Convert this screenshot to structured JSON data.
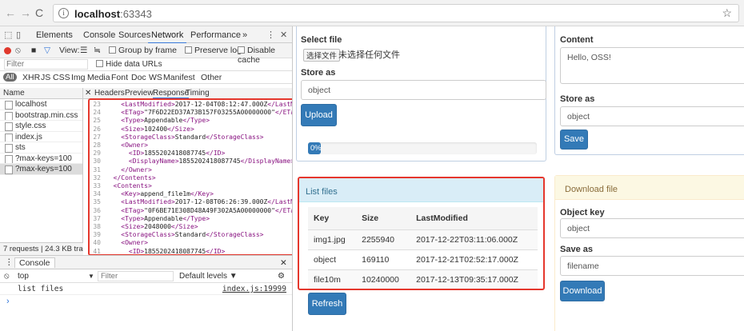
{
  "browser": {
    "url_host": "localhost",
    "url_port": ":63343"
  },
  "devtools": {
    "tabs": [
      "Elements",
      "Console",
      "Sources",
      "Network",
      "Performance",
      "»"
    ],
    "toolbar": {
      "view_label": "View:",
      "group_by_frame": "Group by frame",
      "preserve_log": "Preserve log",
      "disable_cache": "Disable cache"
    },
    "filter_placeholder": "Filter",
    "hide_data_urls": "Hide data URLs",
    "types": [
      "All",
      "XHR",
      "JS",
      "CSS",
      "Img",
      "Media",
      "Font",
      "Doc",
      "WS",
      "Manifest",
      "Other"
    ],
    "name_header": "Name",
    "requests": [
      {
        "name": "localhost",
        "selected": false
      },
      {
        "name": "bootstrap.min.css",
        "selected": false
      },
      {
        "name": "style.css",
        "selected": false
      },
      {
        "name": "index.js",
        "selected": false
      },
      {
        "name": "sts",
        "selected": false
      },
      {
        "name": "?max-keys=100",
        "selected": false
      },
      {
        "name": "?max-keys=100",
        "selected": true
      }
    ],
    "status": "7 requests | 24.3 KB tra...",
    "detail_tabs": [
      "Headers",
      "Preview",
      "Response",
      "Timing"
    ],
    "response_lines": [
      {
        "n": "23",
        "indent": "    ",
        "open": "<LastModified>",
        "text": "2017-12-04T08:12:47.000Z",
        "close": "</LastMod"
      },
      {
        "n": "24",
        "indent": "    ",
        "open": "<ETag>",
        "text": "\"7F6D22ED37A73B157F03255A00000000\"",
        "close": "</ETag>"
      },
      {
        "n": "25",
        "indent": "    ",
        "open": "<Type>",
        "text": "Appendable",
        "close": "</Type>"
      },
      {
        "n": "26",
        "indent": "    ",
        "open": "<Size>",
        "text": "102400",
        "close": "</Size>"
      },
      {
        "n": "27",
        "indent": "    ",
        "open": "<StorageClass>",
        "text": "Standard",
        "close": "</StorageClass>"
      },
      {
        "n": "28",
        "indent": "    ",
        "open": "<Owner>",
        "text": "",
        "close": ""
      },
      {
        "n": "29",
        "indent": "      ",
        "open": "<ID>",
        "text": "1855202418087745",
        "close": "</ID>"
      },
      {
        "n": "30",
        "indent": "      ",
        "open": "<DisplayName>",
        "text": "1855202418087745",
        "close": "</DisplayName>"
      },
      {
        "n": "31",
        "indent": "    ",
        "open": "</Owner>",
        "text": "",
        "close": ""
      },
      {
        "n": "32",
        "indent": "  ",
        "open": "</Contents>",
        "text": "",
        "close": ""
      },
      {
        "n": "33",
        "indent": "  ",
        "open": "<Contents>",
        "text": "",
        "close": ""
      },
      {
        "n": "34",
        "indent": "    ",
        "open": "<Key>",
        "text": "append_file1m",
        "close": "</Key>"
      },
      {
        "n": "35",
        "indent": "    ",
        "open": "<LastModified>",
        "text": "2017-12-08T06:26:39.000Z",
        "close": "</LastMod"
      },
      {
        "n": "36",
        "indent": "    ",
        "open": "<ETag>",
        "text": "\"0F6BE71E308D48A49F302A5A00000000\"",
        "close": "</ETag>"
      },
      {
        "n": "37",
        "indent": "    ",
        "open": "<Type>",
        "text": "Appendable",
        "close": "</Type>"
      },
      {
        "n": "38",
        "indent": "    ",
        "open": "<Size>",
        "text": "2048000",
        "close": "</Size>"
      },
      {
        "n": "39",
        "indent": "    ",
        "open": "<StorageClass>",
        "text": "Standard",
        "close": "</StorageClass>"
      },
      {
        "n": "40",
        "indent": "    ",
        "open": "<Owner>",
        "text": "",
        "close": ""
      },
      {
        "n": "41",
        "indent": "      ",
        "open": "<ID>",
        "text": "1855202418087745",
        "close": "</ID>"
      },
      {
        "n": "42",
        "indent": "      ",
        "open": "<DisplayName>",
        "text": "1855202418087745",
        "close": "</DisplayName>"
      },
      {
        "n": "43",
        "indent": "    ",
        "open": "</Owner>",
        "text": "",
        "close": ""
      },
      {
        "n": "44",
        "indent": "  ",
        "open": "</Contents>",
        "text": "",
        "close": ""
      },
      {
        "n": "45",
        "indent": "  ",
        "open": "<Contents>",
        "text": "",
        "close": ""
      }
    ],
    "console": {
      "tab": "Console",
      "context": "top",
      "filter_placeholder": "Filter",
      "levels": "Default levels ▼",
      "message": "list files",
      "source": "index.js:19999"
    }
  },
  "app": {
    "select_file_label": "Select file",
    "choose_file_btn": "选择文件",
    "no_file_text": "未选择任何文件",
    "store_as_label": "Store as",
    "store_as_value": "object",
    "upload_btn": "Upload",
    "progress_text": "0%",
    "progress_fraction": 0.0,
    "list_files_title": "List files",
    "table": {
      "headers": [
        "Key",
        "Size",
        "LastModified"
      ],
      "rows": [
        [
          "img1.jpg",
          "2255940",
          "2017-12-22T03:11:06.000Z"
        ],
        [
          "object",
          "169110",
          "2017-12-21T02:52:17.000Z"
        ],
        [
          "file10m",
          "10240000",
          "2017-12-13T09:35:17.000Z"
        ]
      ]
    },
    "refresh_btn": "Refresh",
    "content_label": "Content",
    "content_value": "Hello, OSS!",
    "store_as_label_2": "Store as",
    "store_as_value_2": "object",
    "save_btn": "Save",
    "download_title": "Download file",
    "object_key_label": "Object key",
    "object_key_value": "object",
    "save_as_label": "Save as",
    "save_as_value": "filename",
    "download_btn": "Download"
  }
}
